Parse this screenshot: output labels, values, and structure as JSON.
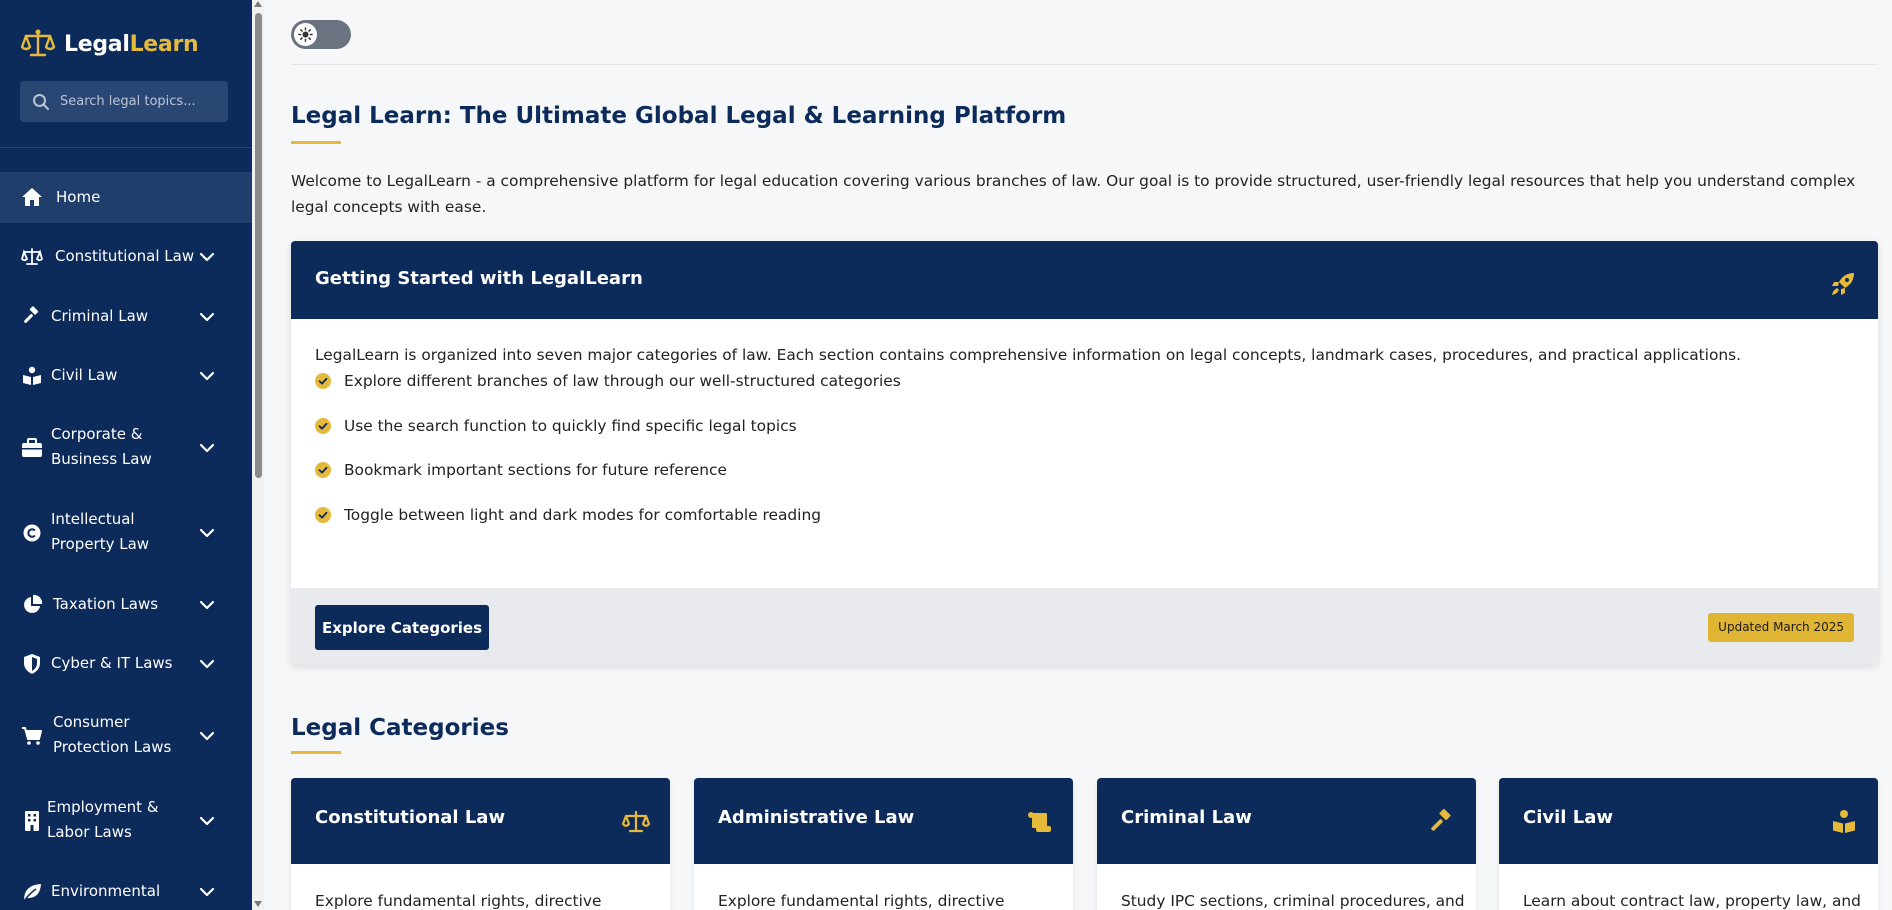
{
  "brand": {
    "name_part1": "Legal",
    "name_part2": "Learn"
  },
  "search": {
    "placeholder": "Search legal topics..."
  },
  "sidebar": {
    "items": [
      {
        "label": "Home",
        "icon": "home-icon",
        "active": true
      },
      {
        "label": "Constitutional Law",
        "icon": "scale-icon"
      },
      {
        "label": "Criminal Law",
        "icon": "gavel-icon"
      },
      {
        "label": "Civil Law",
        "icon": "book-reader-icon"
      },
      {
        "label": "Corporate & Business Law",
        "icon": "briefcase-icon"
      },
      {
        "label": "Intellectual Property Law",
        "icon": "copyright-icon"
      },
      {
        "label": "Taxation Laws",
        "icon": "pie-chart-icon"
      },
      {
        "label": "Cyber & IT Laws",
        "icon": "shield-icon"
      },
      {
        "label": "Consumer Protection Laws",
        "icon": "cart-icon"
      },
      {
        "label": "Employment & Labor Laws",
        "icon": "building-icon"
      },
      {
        "label": "Environmental Laws",
        "icon": "leaf-icon"
      }
    ]
  },
  "main": {
    "title": "Legal Learn: The Ultimate Global Legal & Learning Platform",
    "intro": "Welcome to LegalLearn - a comprehensive platform for legal education covering various branches of law. Our goal is to provide structured, user-friendly legal resources that help you understand complex legal concepts with ease.",
    "getting_started": {
      "title": "Getting Started with LegalLearn",
      "description": "LegalLearn is organized into seven major categories of law. Each section contains comprehensive information on legal concepts, landmark cases, procedures, and practical applications.",
      "points": [
        "Explore different branches of law through our well-structured categories",
        "Use the search function to quickly find specific legal topics",
        "Bookmark important sections for future reference",
        "Toggle between light and dark modes for comfortable reading"
      ],
      "button_label": "Explore Categories",
      "badge": "Updated March 2025"
    },
    "categories_title": "Legal Categories",
    "categories": [
      {
        "title": "Constitutional Law",
        "icon": "scale-icon",
        "description": "Explore fundamental rights, directive"
      },
      {
        "title": "Administrative Law",
        "icon": "scroll-icon",
        "description": "Explore fundamental rights, directive"
      },
      {
        "title": "Criminal Law",
        "icon": "gavel-icon",
        "description": "Study IPC sections, criminal procedures, and"
      },
      {
        "title": "Civil Law",
        "icon": "book-reader-icon",
        "description": "Learn about contract law, property law, and"
      }
    ]
  },
  "colors": {
    "navy": "#0c2a5a",
    "gold": "#e5b93a"
  }
}
